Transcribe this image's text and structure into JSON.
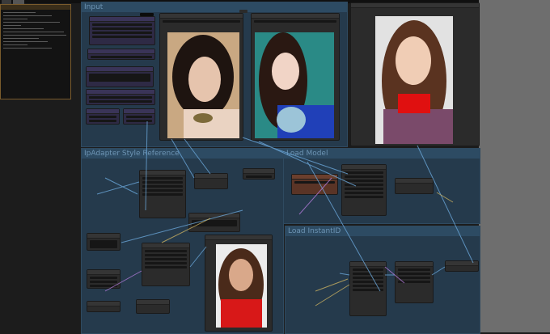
{
  "groups": {
    "input": "Input",
    "ipadapter": "IpAdapter Style Reference",
    "load_model": "Load Model",
    "instantid": "Load InstantID"
  },
  "colors": {
    "canvas": "#1c1c1c",
    "group_bg": "#253a4c",
    "group_title": "#6d94b4",
    "node_bg": "#2b2b2b",
    "notes_border": "#7a5b2c",
    "side_panel": "#6e6e6e"
  },
  "images": {
    "reference_face": "portrait-dark-hair-hand-on-chin",
    "style_reference": "portrait-woman-blue-dress-flowers",
    "output": "portrait-smiling-woman-red-turtleneck",
    "preview": "portrait-smiling-girl-red-sweater"
  }
}
